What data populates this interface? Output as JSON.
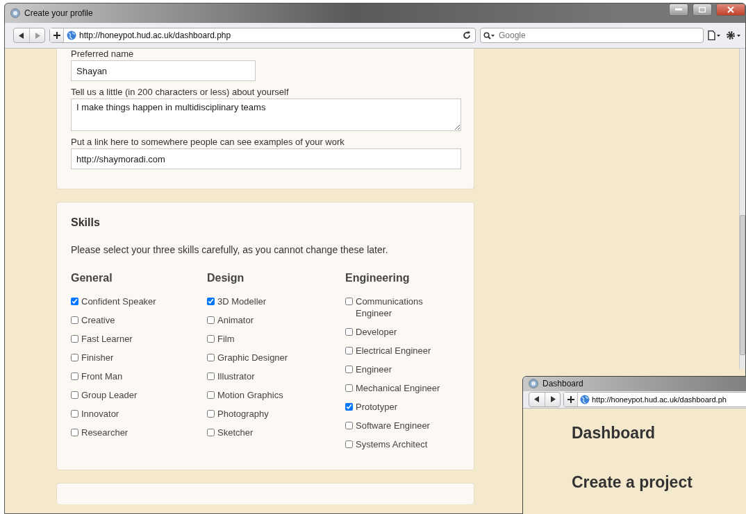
{
  "window": {
    "title": "Create your profile",
    "url": "http://honeypot.hud.ac.uk/dashboard.php",
    "search_placeholder": "Google"
  },
  "profile": {
    "fields": [
      {
        "kind": "input",
        "label": "Preferred name",
        "value": "Shayan"
      },
      {
        "kind": "textarea",
        "label": "Tell us a little (in 200 characters or less) about yourself",
        "value": "I make things happen in multidisciplinary teams"
      },
      {
        "kind": "wide",
        "label": "Put a link here to somewhere people can see examples of your work",
        "value": "http://shaymoradi.com"
      }
    ]
  },
  "skills": {
    "title": "Skills",
    "instruction": "Please select your three skills carefully, as you cannot change these later.",
    "columns": [
      {
        "heading": "General",
        "items": [
          {
            "label": "Confident Speaker",
            "checked": true
          },
          {
            "label": "Creative",
            "checked": false
          },
          {
            "label": "Fast Learner",
            "checked": false
          },
          {
            "label": "Finisher",
            "checked": false
          },
          {
            "label": "Front Man",
            "checked": false
          },
          {
            "label": "Group Leader",
            "checked": false
          },
          {
            "label": "Innovator",
            "checked": false
          },
          {
            "label": "Researcher",
            "checked": false
          }
        ]
      },
      {
        "heading": "Design",
        "items": [
          {
            "label": "3D Modeller",
            "checked": true
          },
          {
            "label": "Animator",
            "checked": false
          },
          {
            "label": "Film",
            "checked": false
          },
          {
            "label": "Graphic Designer",
            "checked": false
          },
          {
            "label": "Illustrator",
            "checked": false
          },
          {
            "label": "Motion Graphics",
            "checked": false
          },
          {
            "label": "Photography",
            "checked": false
          },
          {
            "label": "Sketcher",
            "checked": false
          }
        ]
      },
      {
        "heading": "Engineering",
        "items": [
          {
            "label": "Communications Engineer",
            "checked": false
          },
          {
            "label": "Developer",
            "checked": false
          },
          {
            "label": "Electrical Engineer",
            "checked": false
          },
          {
            "label": "Engineer",
            "checked": false
          },
          {
            "label": "Mechanical Engineer",
            "checked": false
          },
          {
            "label": "Prototyper",
            "checked": true
          },
          {
            "label": "Software Engineer",
            "checked": false
          },
          {
            "label": "Systems Architect",
            "checked": false
          }
        ]
      }
    ]
  },
  "second_window": {
    "title": "Dashboard",
    "url": "http://honeypot.hud.ac.uk/dashboard.ph",
    "headings": [
      "Dashboard",
      "Create a project"
    ]
  }
}
